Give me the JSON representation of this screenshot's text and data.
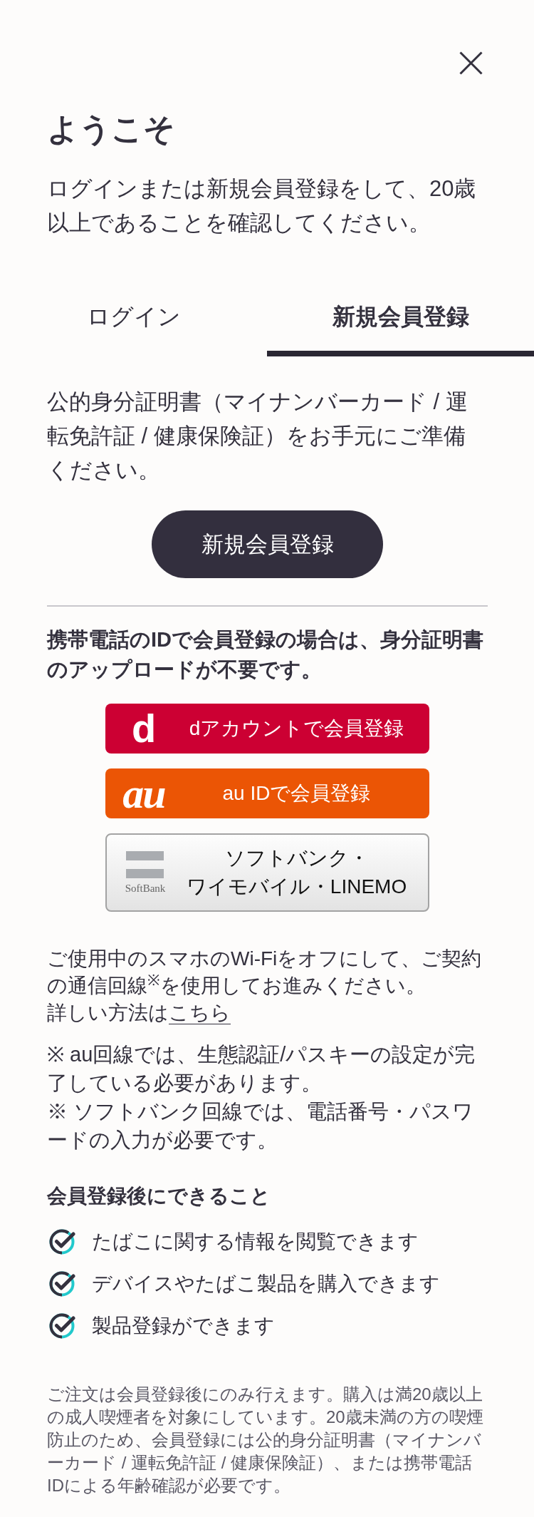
{
  "header": {
    "title": "ようこそ",
    "description": "ログインまたは新規会員登録をして、20歳以上であることを確認してください。"
  },
  "tabs": [
    {
      "label": "ログイン",
      "selected": false
    },
    {
      "label": "新規会員登録",
      "selected": true
    }
  ],
  "register": {
    "instruction": "公的身分証明書（マイナンバーカード / 運転免許証 / 健康保険証）をお手元にご準備ください。",
    "button": "新規会員登録"
  },
  "carrier": {
    "note": "携帯電話のIDで会員登録の場合は、身分証明書のアップロードが不要です。",
    "buttons": [
      {
        "kind": "docomo",
        "logo": "d",
        "label": "dアカウントで会員登録"
      },
      {
        "kind": "au",
        "logo": "au",
        "label": "au IDで会員登録"
      },
      {
        "kind": "softbank",
        "logo": "SoftBank",
        "label": "ソフトバンク・ワイモバイル・LINEMO"
      }
    ]
  },
  "wifi_note": {
    "text": "ご使用中のスマホのWi-Fiをオフにして、ご契約の通信回線$^{※}$を使用してお進みください。",
    "detail": "詳しい方法は",
    "link": "こちら"
  },
  "notes": [
    "※ au回線では、生態認証/パスキーの設定が完了している必要があります。",
    "※ ソフトバンク回線では、電話番号・パスワードの入力が必要です。"
  ],
  "benefits": {
    "title": "会員登録後にできること",
    "items": [
      "たばこに関する情報を閲覧できます",
      "デバイスやたばこ製品を購入できます",
      "製品登録ができます"
    ]
  },
  "disclaimer": "ご注文は会員登録後にのみ行えます。購入は満20歳以上の成人喫煙者を対象にしています。20歳未満の方の喫煙防止のため、会員登録には公的身分証明書（マイナンバーカード / 運転免許証 / 健康保険証）、または携帯電話IDによる年齢確認が必要です。"
}
